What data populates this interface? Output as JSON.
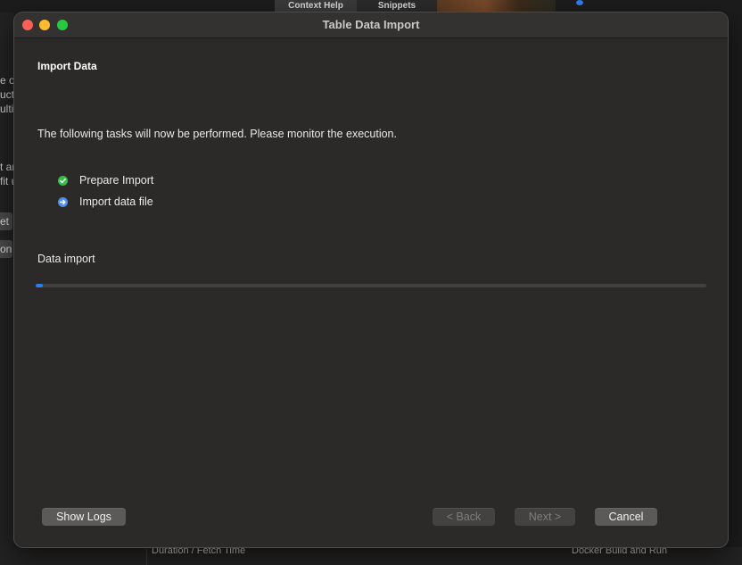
{
  "background": {
    "tabs": [
      "Context Help",
      "Snippets"
    ],
    "left_fragments": [
      "e of",
      "ucto",
      "ulti",
      "t ar",
      "fit u"
    ],
    "left_buttons": [
      "et",
      "on"
    ],
    "bottom_labels": [
      "Duration / Fetch Time",
      "Docker Build and Run"
    ]
  },
  "window": {
    "title": "Table Data Import"
  },
  "page": {
    "heading": "Import Data",
    "intro": "The following tasks will now be performed. Please monitor the execution.",
    "tasks": [
      {
        "label": "Prepare Import",
        "status": "done",
        "icon": "check-circle-icon",
        "color": "#30c142"
      },
      {
        "label": "Import data file",
        "status": "in-progress",
        "icon": "arrow-circle-icon",
        "color": "#4a8ff5"
      }
    ],
    "progress": {
      "label": "Data import",
      "value": 0.01,
      "color": "#2f7df6"
    }
  },
  "buttons": {
    "show_logs": "Show Logs",
    "back": "< Back",
    "next": "Next >",
    "cancel": "Cancel"
  }
}
